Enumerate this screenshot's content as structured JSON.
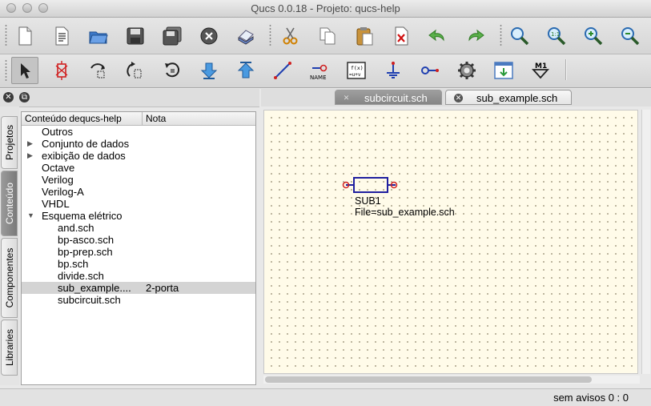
{
  "window": {
    "title": "Qucs 0.0.18 - Projeto: qucs-help"
  },
  "toolbar_main": [
    {
      "name": "new-file-icon"
    },
    {
      "name": "new-text-icon"
    },
    {
      "name": "open-folder-icon"
    },
    {
      "name": "save-icon"
    },
    {
      "name": "save-all-icon"
    },
    {
      "name": "close-doc-icon"
    },
    {
      "name": "print-icon"
    },
    {
      "name": "cut-icon"
    },
    {
      "name": "copy-icon"
    },
    {
      "name": "paste-icon"
    },
    {
      "name": "delete-icon"
    },
    {
      "name": "undo-icon"
    },
    {
      "name": "redo-icon"
    },
    {
      "name": "zoom-fit-icon"
    },
    {
      "name": "zoom-1to1-icon"
    },
    {
      "name": "zoom-in-icon"
    },
    {
      "name": "zoom-out-icon"
    }
  ],
  "toolbar_tools": {
    "items": [
      "select-icon",
      "toggle-active-icon",
      "mirror-x-icon",
      "mirror-y-icon",
      "rotate-icon",
      "go-into-subcircuit-icon",
      "pop-out-icon",
      "wire-icon",
      "wire-label-icon",
      "equation-icon",
      "ground-icon",
      "port-icon",
      "simulate-icon",
      "view-data-icon",
      "marker-icon"
    ],
    "wire_label_text": "NAME",
    "equation_text_1": "f(x)",
    "equation_text_2": "=u+v",
    "marker_text": "M1"
  },
  "left_panel": {
    "close_glyph": "✕",
    "float_glyph": "⧉",
    "tabs": [
      "Projetos",
      "Conteúdo",
      "Componentes",
      "Libraries"
    ],
    "active_tab": "Conteúdo",
    "columns": [
      "Conteúdo dequcs-help",
      "Nota"
    ],
    "rows": [
      {
        "label": "Outros",
        "arrow": "",
        "note": ""
      },
      {
        "label": "Conjunto de dados",
        "arrow": "▶",
        "note": ""
      },
      {
        "label": "exibição de dados",
        "arrow": "▶",
        "note": ""
      },
      {
        "label": "Octave",
        "arrow": "",
        "note": ""
      },
      {
        "label": "Verilog",
        "arrow": "",
        "note": ""
      },
      {
        "label": "Verilog-A",
        "arrow": "",
        "note": ""
      },
      {
        "label": "VHDL",
        "arrow": "",
        "note": ""
      },
      {
        "label": "Esquema elétrico",
        "arrow": "▼",
        "note": ""
      },
      {
        "label": "and.sch",
        "arrow": "",
        "note": ""
      },
      {
        "label": "bp-asco.sch",
        "arrow": "",
        "note": ""
      },
      {
        "label": "bp-prep.sch",
        "arrow": "",
        "note": ""
      },
      {
        "label": "bp.sch",
        "arrow": "",
        "note": ""
      },
      {
        "label": "divide.sch",
        "arrow": "",
        "note": ""
      },
      {
        "label": "sub_example....",
        "arrow": "",
        "note": "2-porta",
        "selected": true
      },
      {
        "label": "subcircuit.sch",
        "arrow": "",
        "note": ""
      }
    ]
  },
  "doc_tabs": [
    {
      "label": "subcircuit.sch",
      "active": true,
      "close": "✕"
    },
    {
      "label": "sub_example.sch",
      "active": false,
      "close": "✕"
    }
  ],
  "schematic": {
    "component_name": "SUB1",
    "component_property": "File=sub_example.sch"
  },
  "status": {
    "text": "sem avisos  0 : 0"
  }
}
